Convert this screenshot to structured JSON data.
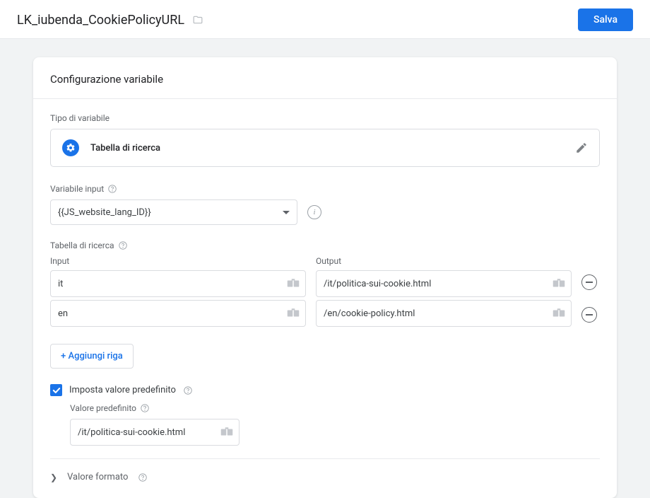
{
  "header": {
    "title": "LK_iubenda_CookiePolicyURL",
    "save_label": "Salva"
  },
  "card": {
    "heading": "Configurazione variabile",
    "type_label": "Tipo di variabile",
    "type_value": "Tabella di ricerca",
    "input_var_label": "Variabile input",
    "input_var_value": "{{JS_website_lang_ID}}",
    "lookup_label": "Tabella di ricerca",
    "col_input": "Input",
    "col_output": "Output",
    "rows": [
      {
        "input": "it",
        "output": "/it/politica-sui-cookie.html"
      },
      {
        "input": "en",
        "output": "/en/cookie-policy.html"
      }
    ],
    "add_row_label": "+ Aggiungi riga",
    "default_checkbox_label": "Imposta valore predefinito",
    "default_value_label": "Valore predefinito",
    "default_value": "/it/politica-sui-cookie.html",
    "format_label": "Valore formato"
  }
}
